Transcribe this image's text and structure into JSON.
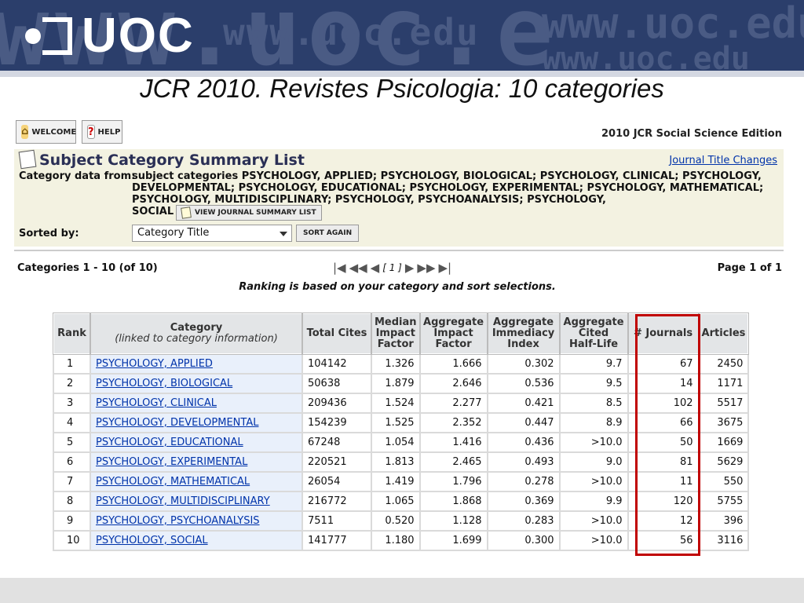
{
  "banner": {
    "logo_text": "UOC",
    "site": "www.uoc.edu"
  },
  "slide_title": "JCR 2010. Revistes Psicologia: 10 categories",
  "toolbar": {
    "welcome": "WELCOME",
    "help": "HELP",
    "edition": "2010 JCR Social Science Edition"
  },
  "summary": {
    "title": "Subject Category Summary List",
    "journal_title_changes": "Journal Title Changes",
    "category_data_label": "Category data from:",
    "category_lines": [
      "subject categories PSYCHOLOGY, APPLIED; PSYCHOLOGY, BIOLOGICAL; PSYCHOLOGY, CLINICAL; PSYCHOLOGY,",
      "DEVELOPMENTAL; PSYCHOLOGY, EDUCATIONAL; PSYCHOLOGY, EXPERIMENTAL; PSYCHOLOGY, MATHEMATICAL;",
      "PSYCHOLOGY, MULTIDISCIPLINARY; PSYCHOLOGY, PSYCHOANALYSIS; PSYCHOLOGY,",
      "SOCIAL"
    ],
    "view_button": "VIEW JOURNAL SUMMARY LIST",
    "sorted_by_label": "Sorted by:",
    "sort_value": "Category Title",
    "sort_again": "SORT AGAIN"
  },
  "paging": {
    "categories": "Categories 1 - 10 (of 10)",
    "current": "[ 1 ]",
    "page_of": "Page 1 of 1",
    "ranking_note": "Ranking is based on your category and sort selections."
  },
  "table": {
    "headers": {
      "rank": "Rank",
      "category": "Category",
      "category_sub": "(linked to category information)",
      "total_cites": "Total Cites",
      "median_if_1": "Median",
      "median_if_2": "Impact",
      "median_if_3": "Factor",
      "agg_if_1": "Aggregate",
      "agg_if_2": "Impact",
      "agg_if_3": "Factor",
      "agg_ii_1": "Aggregate",
      "agg_ii_2": "Immediacy",
      "agg_ii_3": "Index",
      "agg_chl_1": "Aggregate",
      "agg_chl_2": "Cited",
      "agg_chl_3": "Half-Life",
      "journals": "# Journals",
      "articles": "Articles"
    },
    "rows": [
      {
        "rank": "1",
        "category": "PSYCHOLOGY, APPLIED",
        "total_cites": "104142",
        "median_if": "1.326",
        "agg_if": "1.666",
        "agg_ii": "0.302",
        "agg_chl": "9.7",
        "journals": "67",
        "articles": "2450"
      },
      {
        "rank": "2",
        "category": "PSYCHOLOGY, BIOLOGICAL",
        "total_cites": "50638",
        "median_if": "1.879",
        "agg_if": "2.646",
        "agg_ii": "0.536",
        "agg_chl": "9.5",
        "journals": "14",
        "articles": "1171"
      },
      {
        "rank": "3",
        "category": "PSYCHOLOGY, CLINICAL",
        "total_cites": "209436",
        "median_if": "1.524",
        "agg_if": "2.277",
        "agg_ii": "0.421",
        "agg_chl": "8.5",
        "journals": "102",
        "articles": "5517"
      },
      {
        "rank": "4",
        "category": "PSYCHOLOGY, DEVELOPMENTAL",
        "total_cites": "154239",
        "median_if": "1.525",
        "agg_if": "2.352",
        "agg_ii": "0.447",
        "agg_chl": "8.9",
        "journals": "66",
        "articles": "3675"
      },
      {
        "rank": "5",
        "category": "PSYCHOLOGY, EDUCATIONAL",
        "total_cites": "67248",
        "median_if": "1.054",
        "agg_if": "1.416",
        "agg_ii": "0.436",
        "agg_chl": ">10.0",
        "journals": "50",
        "articles": "1669"
      },
      {
        "rank": "6",
        "category": "PSYCHOLOGY, EXPERIMENTAL",
        "total_cites": "220521",
        "median_if": "1.813",
        "agg_if": "2.465",
        "agg_ii": "0.493",
        "agg_chl": "9.0",
        "journals": "81",
        "articles": "5629"
      },
      {
        "rank": "7",
        "category": "PSYCHOLOGY, MATHEMATICAL",
        "total_cites": "26054",
        "median_if": "1.419",
        "agg_if": "1.796",
        "agg_ii": "0.278",
        "agg_chl": ">10.0",
        "journals": "11",
        "articles": "550"
      },
      {
        "rank": "8",
        "category": "PSYCHOLOGY, MULTIDISCIPLINARY",
        "total_cites": "216772",
        "median_if": "1.065",
        "agg_if": "1.868",
        "agg_ii": "0.369",
        "agg_chl": "9.9",
        "journals": "120",
        "articles": "5755"
      },
      {
        "rank": "9",
        "category": "PSYCHOLOGY, PSYCHOANALYSIS",
        "total_cites": "7511",
        "median_if": "0.520",
        "agg_if": "1.128",
        "agg_ii": "0.283",
        "agg_chl": ">10.0",
        "journals": "12",
        "articles": "396"
      },
      {
        "rank": "10",
        "category": "PSYCHOLOGY, SOCIAL",
        "total_cites": "141777",
        "median_if": "1.180",
        "agg_if": "1.699",
        "agg_ii": "0.300",
        "agg_chl": ">10.0",
        "journals": "56",
        "articles": "3116"
      }
    ]
  },
  "colors": {
    "banner": "#2b3e6b",
    "highlight": "#c00000",
    "link": "#0033aa",
    "panel": "#f3f2e1"
  }
}
